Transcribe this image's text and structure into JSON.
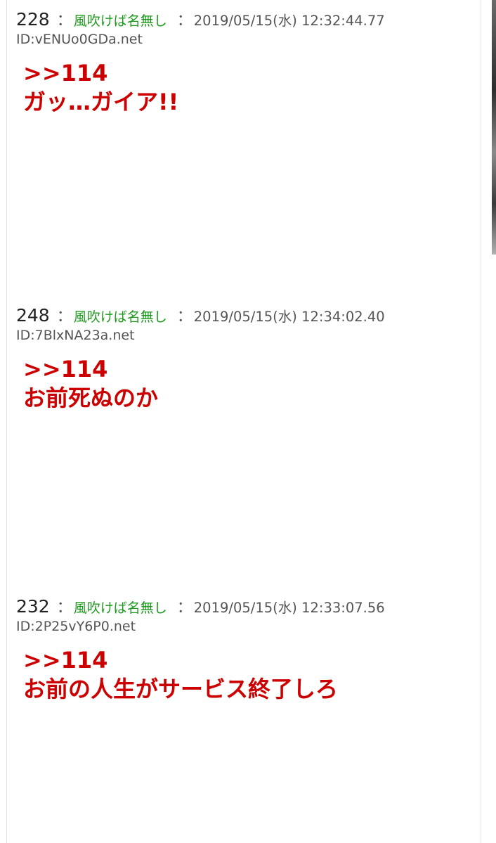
{
  "posts": [
    {
      "number": "228",
      "separator": "：",
      "author": "風吹けば名無し",
      "date_separator": "：",
      "datetime": "2019/05/15(水) 12:32:44.77",
      "id": "ID:vENUo0GDa.net",
      "anchor": ">>114",
      "body": "ガッ…ガイア!!"
    },
    {
      "number": "248",
      "separator": "：",
      "author": "風吹けば名無し",
      "date_separator": "：",
      "datetime": "2019/05/15(水) 12:34:02.40",
      "id": "ID:7BlxNA23a.net",
      "anchor": ">>114",
      "body": "お前死ぬのか"
    },
    {
      "number": "232",
      "separator": "：",
      "author": "風吹けば名無し",
      "date_separator": "：",
      "datetime": "2019/05/15(水) 12:33:07.56",
      "id": "ID:2P25vY6P0.net",
      "anchor": ">>114",
      "body": "お前の人生がサービス終了しろ"
    }
  ],
  "colors": {
    "author": "#1d9a1d",
    "body": "#cc0000",
    "meta": "#555555"
  }
}
